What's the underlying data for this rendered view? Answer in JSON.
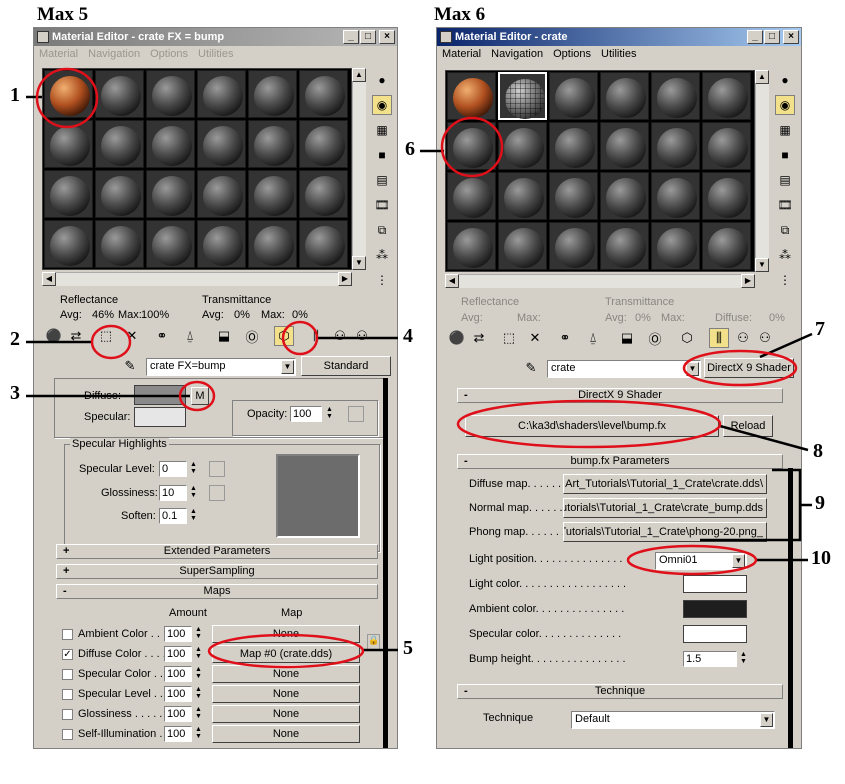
{
  "headings": {
    "left": "Max 5",
    "right": "Max 6"
  },
  "max5": {
    "title": "Material Editor - crate FX = bump",
    "menu": [
      "Material",
      "Navigation",
      "Options",
      "Utilities"
    ],
    "reflectance": {
      "label": "Reflectance",
      "avg": "Avg:",
      "avg_value": "46%",
      "max": "Max:",
      "max_value": "100%"
    },
    "transmittance": {
      "label": "Transmittance",
      "avg": "Avg:",
      "avg_value": "0%",
      "max": "Max:",
      "max_value": "0%"
    },
    "material_name": "crate FX=bump",
    "type_button": "Standard",
    "diffuse_label": "Diffuse:",
    "specular_label": "Specular:",
    "m_button": "M",
    "opacity_label": "Opacity:",
    "opacity_value": "100",
    "specular_highlights": {
      "title": "Specular Highlights",
      "level_label": "Specular Level:",
      "level_value": "0",
      "gloss_label": "Glossiness:",
      "gloss_value": "10",
      "soften_label": "Soften:",
      "soften_value": "0.1"
    },
    "rollouts": [
      {
        "sign": "+",
        "label": "Extended Parameters"
      },
      {
        "sign": "+",
        "label": "SuperSampling"
      },
      {
        "sign": "-",
        "label": "Maps"
      }
    ],
    "maps_header": {
      "amount": "Amount",
      "map": "Map"
    },
    "maps": [
      {
        "label": "Ambient Color . . .",
        "checked": false,
        "amount": "100",
        "map": "None"
      },
      {
        "label": "Diffuse Color . . . .",
        "checked": true,
        "amount": "100",
        "map": "Map #0 (crate.dds)"
      },
      {
        "label": "Specular Color . .",
        "checked": false,
        "amount": "100",
        "map": "None"
      },
      {
        "label": "Specular Level . .",
        "checked": false,
        "amount": "100",
        "map": "None"
      },
      {
        "label": "Glossiness . . . . .",
        "checked": false,
        "amount": "100",
        "map": "None"
      },
      {
        "label": "Self-Illumination .",
        "checked": false,
        "amount": "100",
        "map": "None"
      }
    ]
  },
  "max6": {
    "title": "Material Editor - crate",
    "menu": [
      "Material",
      "Navigation",
      "Options",
      "Utilities"
    ],
    "reflectance": {
      "label": "Reflectance",
      "avg": "Avg:",
      "max": "Max:"
    },
    "transmittance": {
      "label": "Transmittance",
      "avg": "Avg:",
      "avg_value": "0%",
      "max": "Max:",
      "diffuse": "Diffuse:",
      "diffuse_value": "0%"
    },
    "material_name": "crate",
    "type_button": "DirectX 9 Shader",
    "shader_rollout": {
      "sign": "-",
      "label": "DirectX 9 Shader"
    },
    "shader_path": "C:\\ka3d\\shaders\\level\\bump.fx",
    "reload_button": "Reload",
    "params_rollout": {
      "sign": "-",
      "label": "bump.fx Parameters"
    },
    "params": [
      {
        "label": "Diffuse map. . . . . . . .",
        "value": "\\Art_Tutorials\\Tutorial_1_Crate\\crate.dds"
      },
      {
        "label": "Normal map. . . . . . . .",
        "value": "utorials\\Tutorial_1_Crate\\crate_bump.dds"
      },
      {
        "label": "Phong map. . . . . . .",
        "value": "_Tutorials\\Tutorial_1_Crate\\phong-20.png"
      }
    ],
    "light_position_label": "Light position. . . . . . . . . . . . . . .",
    "light_position_value": "Omni01",
    "light_color_label": "Light color. . . . . . . . . . . . . . . . . .",
    "ambient_color_label": "Ambient color. . . . . . . . . . . . . . .",
    "specular_color_label": "Specular color. . . . . . . . . . . . . .",
    "bump_height_label": "Bump height. . . . . . . . . . . . . . . .",
    "bump_height_value": "1.5",
    "colors": {
      "light": "#ffffff",
      "ambient": "#1e1e1e",
      "specular": "#ffffff"
    },
    "technique_rollout": {
      "sign": "-",
      "label": "Technique"
    },
    "technique_label": "Technique",
    "technique_value": "Default"
  },
  "annotations": [
    "1",
    "2",
    "3",
    "4",
    "5",
    "6",
    "7",
    "8",
    "9",
    "10"
  ],
  "highlight_color": "#e0101a"
}
